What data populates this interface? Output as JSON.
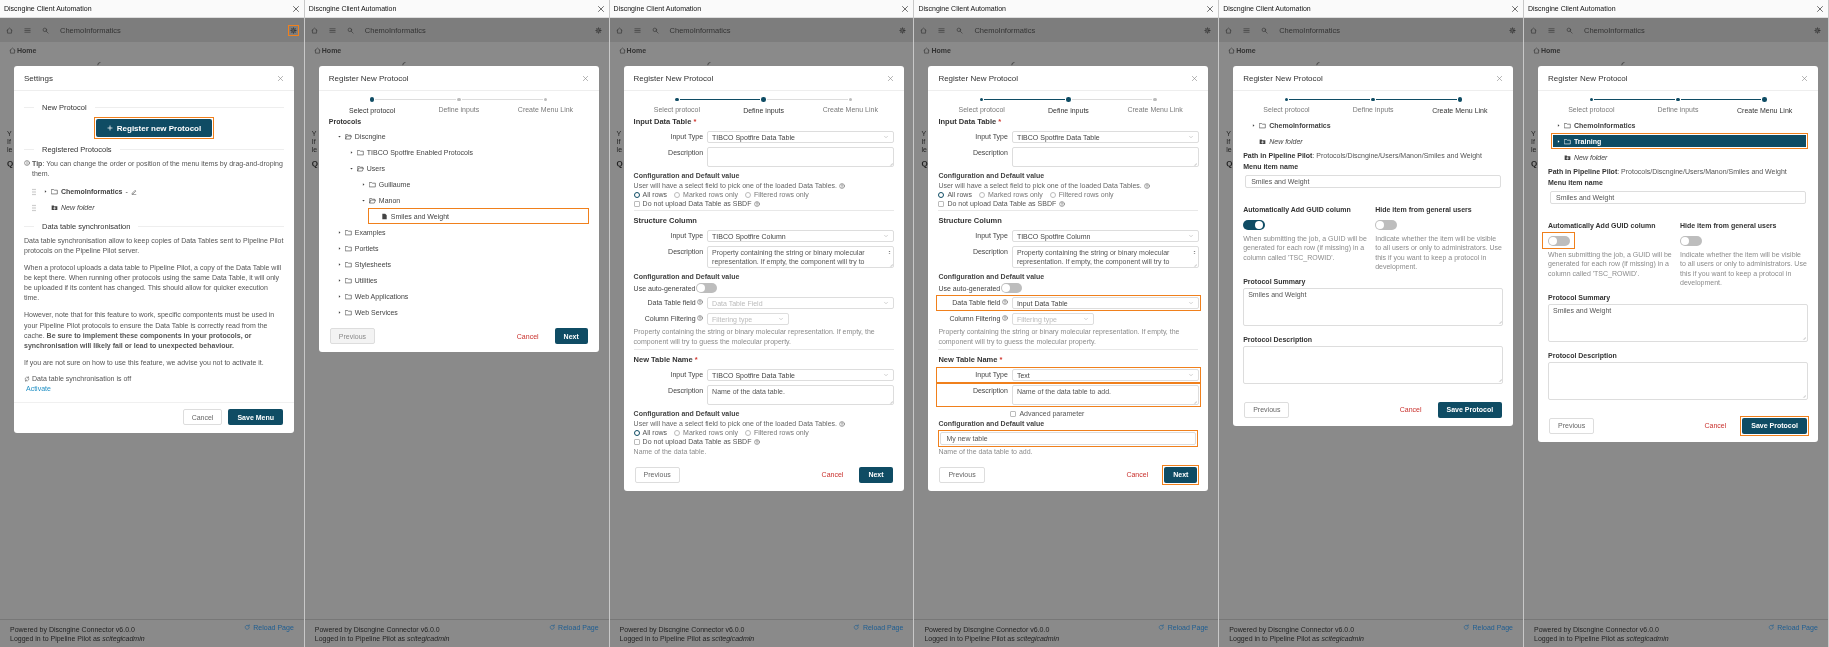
{
  "panels": [
    {
      "kind": "settings",
      "window": {
        "title": "Discngine Client Automation"
      },
      "toolbar": {
        "title": "ChemoInformatics",
        "settings_highlighted": true
      },
      "breadcrumb": "Home",
      "fragments": [
        "Y",
        "If",
        "le",
        "Q"
      ],
      "dialog": {
        "title": "Settings",
        "sections": [
          {
            "heading": "New Protocol",
            "rows": [
              {
                "kind": "action",
                "label": "Register new Protocol",
                "highlighted": true
              }
            ]
          },
          {
            "heading": "Registered Protocols",
            "rows": [
              {
                "kind": "tip",
                "text": "**Tip**: You can change the order or position of the menu items by drag-and-droping them."
              },
              {
                "kind": "menu_tree",
                "draggable": true,
                "nodes": [
                  {
                    "kind": "folder",
                    "label": "ChemoInformatics",
                    "suffix": "-",
                    "editable": true,
                    "expanded": false
                  },
                  {
                    "kind": "new_folder",
                    "label": "New folder"
                  }
                ]
              }
            ]
          },
          {
            "heading": "Data table synchronisation",
            "rows": [
              {
                "kind": "paragraph",
                "text": "Data table synchronisation allow to keep copies of Data Tables sent to Pipeline Pilot protocols on the Pipeline Pilot server."
              },
              {
                "kind": "paragraph",
                "text": "When a protocol uploads a data table to Pipeline Pilot, a copy of the Data Table will be kept there. When running other protocols using the same Data Table, it will only be uploaded if its content has changed. This should allow for quicker execution time."
              },
              {
                "kind": "paragraph",
                "text": "However, note that for this feature to work, specific compontents must be used in your Pipeline Pilot protocols to ensure the Data Table is correctly read from the cache. **Be sure to implement these components in your protocols, or synchronisation will likely fail or lead to unexpected behaviour.**"
              },
              {
                "kind": "paragraph",
                "text": "If you are not sure on how to use this feature, we advise you not to activate it."
              },
              {
                "kind": "status",
                "text": "Data table synchronisation is off"
              },
              {
                "kind": "link",
                "text": "Activate"
              }
            ]
          }
        ],
        "buttons": [
          {
            "label": "Cancel",
            "kind": "outline"
          },
          {
            "label": "Save Menu",
            "kind": "primary"
          }
        ]
      },
      "footer": {
        "powered": "Powered by Discngine Connector v6.0.0",
        "login": "Logged in to Pipeline Pilot as *scitegicadmin*",
        "reload": "Reload Page"
      }
    },
    {
      "kind": "wizard",
      "window": {
        "title": "Discngine Client Automation"
      },
      "toolbar": {
        "title": "ChemoInformatics",
        "settings_highlighted": false
      },
      "breadcrumb": "Home",
      "fragments": [
        "Y",
        "If",
        "le",
        "Q"
      ],
      "dialog": {
        "title": "Register New Protocol",
        "steps": [
          {
            "label": "Select protocol",
            "reached": true,
            "selected": true
          },
          {
            "label": "Define inputs",
            "reached": false,
            "selected": false
          },
          {
            "label": "Create Menu Link",
            "reached": false,
            "selected": false
          }
        ],
        "sections": [
          {
            "rows": [
              {
                "kind": "heading",
                "text": "Protocols"
              },
              {
                "kind": "protocol_tree",
                "nodes": [
                  {
                    "kind": "folder",
                    "label": "Discngine",
                    "expanded": true,
                    "children": [
                      {
                        "kind": "folder",
                        "label": "TIBCO Spotfire Enabled Protocols",
                        "expanded": false
                      },
                      {
                        "kind": "folder",
                        "label": "Users",
                        "expanded": true,
                        "children": [
                          {
                            "kind": "folder",
                            "label": "Guillaume",
                            "expanded": false
                          },
                          {
                            "kind": "folder",
                            "label": "Manon",
                            "expanded": true,
                            "children": [
                              {
                                "kind": "file",
                                "label": "Smiles and Weight",
                                "highlighted": true
                              }
                            ]
                          }
                        ]
                      }
                    ]
                  },
                  {
                    "kind": "folder",
                    "label": "Examples",
                    "expanded": false
                  },
                  {
                    "kind": "folder",
                    "label": "Portlets",
                    "expanded": false
                  },
                  {
                    "kind": "folder",
                    "label": "Stylesheets",
                    "expanded": false
                  },
                  {
                    "kind": "folder",
                    "label": "Utilities",
                    "expanded": false
                  },
                  {
                    "kind": "folder",
                    "label": "Web Applications",
                    "expanded": false
                  },
                  {
                    "kind": "folder",
                    "label": "Web Services",
                    "expanded": false
                  }
                ]
              }
            ]
          }
        ],
        "buttons": [
          {
            "label": "Previous",
            "kind": "outline",
            "disabled": true
          },
          {
            "label": "Cancel",
            "kind": "text"
          },
          {
            "label": "Next",
            "kind": "primary"
          }
        ]
      },
      "footer": {
        "powered": "Powered by Discngine Connector v6.0.0",
        "login": "Logged in to Pipeline Pilot as *scitegicadmin*",
        "reload": "Reload Page"
      }
    },
    {
      "kind": "wizard",
      "window": {
        "title": "Discngine Client Automation"
      },
      "toolbar": {
        "title": "ChemoInformatics",
        "settings_highlighted": false
      },
      "breadcrumb": "Home",
      "fragments": [
        "Y",
        "If",
        "le",
        "Q"
      ],
      "dialog": {
        "title": "Register New Protocol",
        "steps": [
          {
            "label": "Select protocol",
            "reached": true,
            "selected": false
          },
          {
            "label": "Define inputs",
            "reached": true,
            "selected": true
          },
          {
            "label": "Create Menu Link",
            "reached": false,
            "selected": false
          }
        ],
        "sections": [
          {
            "title": "Input Data Table",
            "mark": "*",
            "rows": [
              {
                "kind": "select",
                "label": "Input Type",
                "value": "TIBCO Spotfire Data Table"
              },
              {
                "kind": "textarea",
                "label": "Description"
              },
              {
                "kind": "subheading",
                "text": "Configuration and Default value"
              },
              {
                "kind": "hint",
                "text": "User will have a select field to pick one of the loaded Data Tables.",
                "help": true
              },
              {
                "kind": "radios",
                "options": [
                  {
                    "label": "All rows",
                    "selected": true
                  },
                  {
                    "label": "Marked rows only",
                    "selected": false
                  },
                  {
                    "label": "Filtered rows only",
                    "selected": false
                  }
                ]
              },
              {
                "kind": "checkbox",
                "label": "Do not upload Data Table as SBDF",
                "checked": false,
                "help": true
              }
            ]
          },
          {
            "title": "Structure Column",
            "rows": [
              {
                "kind": "select",
                "label": "Input Type",
                "value": "TIBCO Spotfire Column"
              },
              {
                "kind": "textarea",
                "label": "Description",
                "value": "Property containing the string or binary molecular representation. If empty, the component will try to",
                "scrollbar": true
              },
              {
                "kind": "subheading",
                "text": "Configuration and Default value"
              },
              {
                "kind": "toggle",
                "label": "Use auto-generated",
                "on": false
              },
              {
                "kind": "select",
                "label": "Data Table field",
                "help": true,
                "placeholder": "Data Table Field"
              },
              {
                "kind": "small_select",
                "label": "Column Filtering",
                "help": true,
                "placeholder": "Filtering type"
              },
              {
                "kind": "note",
                "text": "Property containing the string or binary molecular representation. If empty, the component will try to guess the molecular property."
              }
            ]
          },
          {
            "title": "New Table Name",
            "mark": "*",
            "rows": [
              {
                "kind": "select",
                "label": "Input Type",
                "value": "TIBCO Spotfire Data Table"
              },
              {
                "kind": "textarea",
                "label": "Description",
                "value": "Name of the data table."
              },
              {
                "kind": "subheading",
                "text": "Configuration and Default value"
              },
              {
                "kind": "hint",
                "text": "User will have a select field to pick one of the loaded Data Tables.",
                "help": true
              },
              {
                "kind": "radios",
                "options": [
                  {
                    "label": "All rows",
                    "selected": true
                  },
                  {
                    "label": "Marked rows only",
                    "selected": false
                  },
                  {
                    "label": "Filtered rows only",
                    "selected": false
                  }
                ]
              },
              {
                "kind": "checkbox",
                "label": "Do not upload Data Table as SBDF",
                "checked": false,
                "help": true
              },
              {
                "kind": "note",
                "text": "Name of the data table."
              }
            ]
          }
        ],
        "buttons": [
          {
            "label": "Previous",
            "kind": "outline",
            "disabled": false
          },
          {
            "label": "Cancel",
            "kind": "text"
          },
          {
            "label": "Next",
            "kind": "primary"
          }
        ]
      },
      "footer": {
        "powered": "Powered by Discngine Connector v6.0.0",
        "login": "Logged in to Pipeline Pilot as *scitegicadmin*",
        "reload": "Reload Page"
      }
    },
    {
      "kind": "wizard",
      "window": {
        "title": "Discngine Client Automation"
      },
      "toolbar": {
        "title": "ChemoInformatics",
        "settings_highlighted": false
      },
      "breadcrumb": "Home",
      "fragments": [
        "Y",
        "If",
        "le",
        "Q"
      ],
      "dialog": {
        "title": "Register New Protocol",
        "steps": [
          {
            "label": "Select protocol",
            "reached": true,
            "selected": false
          },
          {
            "label": "Define inputs",
            "reached": true,
            "selected": true
          },
          {
            "label": "Create Menu Link",
            "reached": false,
            "selected": false
          }
        ],
        "sections": [
          {
            "title": "Input Data Table",
            "mark": "*",
            "rows": [
              {
                "kind": "select",
                "label": "Input Type",
                "value": "TIBCO Spotfire Data Table"
              },
              {
                "kind": "textarea",
                "label": "Description"
              },
              {
                "kind": "subheading",
                "text": "Configuration and Default value"
              },
              {
                "kind": "hint",
                "text": "User will have a select field to pick one of the loaded Data Tables.",
                "help": true
              },
              {
                "kind": "radios",
                "options": [
                  {
                    "label": "All rows",
                    "selected": true
                  },
                  {
                    "label": "Marked rows only",
                    "selected": false
                  },
                  {
                    "label": "Filtered rows only",
                    "selected": false
                  }
                ]
              },
              {
                "kind": "checkbox",
                "label": "Do not upload Data Table as SBDF",
                "checked": false,
                "help": true
              }
            ]
          },
          {
            "title": "Structure Column",
            "rows": [
              {
                "kind": "select",
                "label": "Input Type",
                "value": "TIBCO Spotfire Column"
              },
              {
                "kind": "textarea",
                "label": "Description",
                "value": "Property containing the string or binary molecular representation. If empty, the component will try to",
                "scrollbar": true
              },
              {
                "kind": "subheading",
                "text": "Configuration and Default value"
              },
              {
                "kind": "toggle",
                "label": "Use auto-generated",
                "on": false
              },
              {
                "kind": "select",
                "label": "Data Table field",
                "help": true,
                "value": "Input Data Table",
                "highlighted": true
              },
              {
                "kind": "small_select",
                "label": "Column Filtering",
                "help": true,
                "placeholder": "Filtering type"
              },
              {
                "kind": "note",
                "text": "Property containing the string or binary molecular representation. If empty, the component will try to guess the molecular property."
              }
            ]
          },
          {
            "title": "New Table Name",
            "mark": "*",
            "rows": [
              {
                "kind": "select",
                "label": "Input Type",
                "value": "Text",
                "highlighted": true
              },
              {
                "kind": "textarea",
                "label": "Description",
                "value": "Name of the data table to add.",
                "highlighted": true
              },
              {
                "kind": "field_checkbox",
                "label": "Advanced parameter",
                "checked": false
              },
              {
                "kind": "subheading",
                "text": "Configuration and Default value"
              },
              {
                "kind": "input",
                "value": "My new table",
                "highlighted": true
              },
              {
                "kind": "note",
                "text": "Name of the data table to add."
              }
            ]
          }
        ],
        "buttons": [
          {
            "label": "Previous",
            "kind": "outline",
            "disabled": false
          },
          {
            "label": "Cancel",
            "kind": "text"
          },
          {
            "label": "Next",
            "kind": "primary",
            "highlighted": true
          }
        ]
      },
      "footer": {
        "powered": "Powered by Discngine Connector v6.0.0",
        "login": "Logged in to Pipeline Pilot as *scitegicadmin*",
        "reload": "Reload Page"
      }
    },
    {
      "kind": "wizard",
      "window": {
        "title": "Discngine Client Automation"
      },
      "toolbar": {
        "title": "ChemoInformatics",
        "settings_highlighted": false
      },
      "breadcrumb": "Home",
      "fragments": [
        "Y",
        "If",
        "le",
        "Q"
      ],
      "dialog": {
        "title": "Register New Protocol",
        "steps": [
          {
            "label": "Select protocol",
            "reached": true,
            "selected": false
          },
          {
            "label": "Define inputs",
            "reached": true,
            "selected": false
          },
          {
            "label": "Create Menu Link",
            "reached": true,
            "selected": true
          }
        ],
        "sections": [
          {
            "rows": [
              {
                "kind": "menu_tree",
                "nodes": [
                  {
                    "kind": "folder",
                    "label": "ChemoInformatics",
                    "expanded": false,
                    "selected": false
                  },
                  {
                    "kind": "new_folder",
                    "label": "New folder",
                    "selected": false
                  }
                ]
              },
              {
                "kind": "path",
                "text": "**Path in Pipeline Pilot**: Protocols/Discngine/Users/Manon/Smiles and Weight"
              },
              {
                "kind": "heading",
                "text": "Menu item name"
              },
              {
                "kind": "input",
                "value": "Smiles and Weight"
              },
              {
                "kind": "toggle_columns",
                "columns": [
                  {
                    "title": "Automatically Add GUID column",
                    "on": true,
                    "text": "When submitting the job, a GUID will be generated for each row (if missing) in a column called 'TSC_ROWID'."
                  },
                  {
                    "title": "Hide item from general users",
                    "on": false,
                    "text": "Indicate whether the item will be visible to all users or only to administrators. Use this if you want to keep a protocol in development."
                  }
                ]
              },
              {
                "kind": "heading",
                "text": "Protocol Summary"
              },
              {
                "kind": "block_textarea",
                "value": "Smiles and Weight"
              },
              {
                "kind": "heading",
                "text": "Protocol Description"
              },
              {
                "kind": "block_textarea"
              }
            ]
          }
        ],
        "buttons": [
          {
            "label": "Previous",
            "kind": "outline",
            "disabled": false
          },
          {
            "label": "Cancel",
            "kind": "text"
          },
          {
            "label": "Save Protocol",
            "kind": "primary"
          }
        ]
      },
      "footer": {
        "powered": "Powered by Discngine Connector v6.0.0",
        "login": "Logged in to Pipeline Pilot as *scitegicadmin*",
        "reload": "Reload Page"
      }
    },
    {
      "kind": "wizard",
      "window": {
        "title": "Discngine Client Automation"
      },
      "toolbar": {
        "title": "ChemoInformatics",
        "settings_highlighted": false
      },
      "breadcrumb": "Home",
      "fragments": [
        "Y",
        "If",
        "le",
        "Q"
      ],
      "dialog": {
        "title": "Register New Protocol",
        "steps": [
          {
            "label": "Select protocol",
            "reached": true,
            "selected": false
          },
          {
            "label": "Define inputs",
            "reached": true,
            "selected": false
          },
          {
            "label": "Create Menu Link",
            "reached": true,
            "selected": true
          }
        ],
        "sections": [
          {
            "rows": [
              {
                "kind": "menu_tree",
                "nodes": [
                  {
                    "kind": "folder",
                    "label": "ChemoInformatics",
                    "expanded": false,
                    "selected": false
                  },
                  {
                    "kind": "folder",
                    "label": "Training",
                    "expanded": false,
                    "selected": true,
                    "highlighted": true
                  },
                  {
                    "kind": "new_folder",
                    "label": "New folder",
                    "selected": false
                  }
                ]
              },
              {
                "kind": "path",
                "text": "**Path in Pipeline Pilot**: Protocols/Discngine/Users/Manon/Smiles and Weight"
              },
              {
                "kind": "heading",
                "text": "Menu item name"
              },
              {
                "kind": "input",
                "value": "Smiles and Weight"
              },
              {
                "kind": "toggle_columns",
                "columns": [
                  {
                    "title": "Automatically Add GUID column",
                    "on": false,
                    "highlighted": true,
                    "text": "When submitting the job, a GUID will be generated for each row (if missing) in a column called 'TSC_ROWID'."
                  },
                  {
                    "title": "Hide item from general users",
                    "on": false,
                    "text": "Indicate whether the item will be visible to all users or only to administrators. Use this if you want to keep a protocol in development."
                  }
                ]
              },
              {
                "kind": "heading",
                "text": "Protocol Summary"
              },
              {
                "kind": "block_textarea",
                "value": "Smiles and Weight"
              },
              {
                "kind": "heading",
                "text": "Protocol Description"
              },
              {
                "kind": "block_textarea"
              }
            ]
          }
        ],
        "buttons": [
          {
            "label": "Previous",
            "kind": "outline",
            "disabled": false
          },
          {
            "label": "Cancel",
            "kind": "text"
          },
          {
            "label": "Save Protocol",
            "kind": "primary",
            "highlighted": true
          }
        ]
      },
      "footer": {
        "powered": "Powered by Discngine Connector v6.0.0",
        "login": "Logged in to Pipeline Pilot as *scitegicadmin*",
        "reload": "Reload Page"
      }
    }
  ]
}
